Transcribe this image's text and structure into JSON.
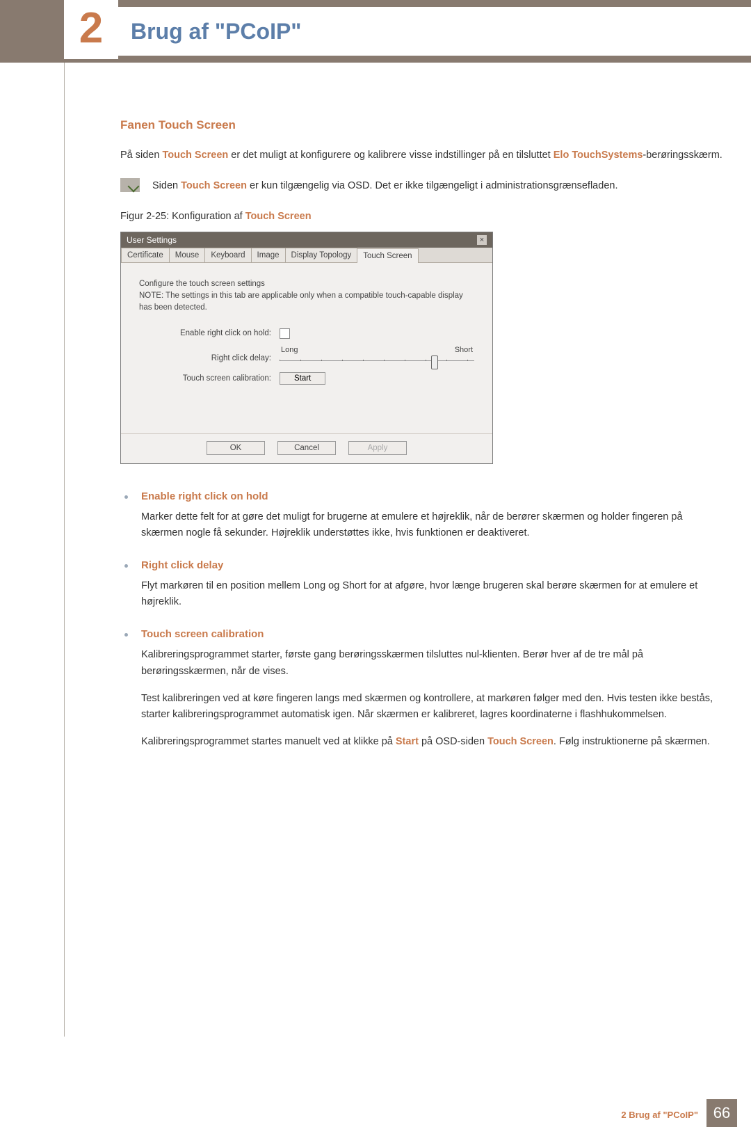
{
  "chapter": {
    "number": "2",
    "title": "Brug af \"PCoIP\""
  },
  "section": {
    "heading": "Fanen Touch Screen",
    "para1_pre": "På siden ",
    "para1_hl1": "Touch Screen",
    "para1_mid": " er det muligt at konfigurere og kalibrere visse indstillinger på en tilsluttet ",
    "para1_hl2": "Elo TouchSystems",
    "para1_post": "-berøringsskærm."
  },
  "note": {
    "pre": "Siden ",
    "hl": "Touch Screen",
    "post": " er kun tilgængelig via OSD. Det er ikke tilgængeligt i administrationsgrænsefladen."
  },
  "figure": {
    "caption_pre": "Figur 2-25: Konfiguration af ",
    "caption_hl": "Touch Screen"
  },
  "screenshot": {
    "window_title": "User Settings",
    "tabs": [
      "Certificate",
      "Mouse",
      "Keyboard",
      "Image",
      "Display Topology",
      "Touch Screen"
    ],
    "active_tab": "Touch Screen",
    "intro_line1": "Configure the touch screen settings",
    "intro_line2": "NOTE: The settings in this tab are applicable only when a compatible touch-capable display has been detected.",
    "labels": {
      "enable_hold": "Enable right click on hold:",
      "delay": "Right click delay:",
      "calibration": "Touch screen calibration:"
    },
    "slider": {
      "left": "Long",
      "right": "Short"
    },
    "start_button": "Start",
    "buttons": {
      "ok": "OK",
      "cancel": "Cancel",
      "apply": "Apply"
    }
  },
  "features": {
    "item1": {
      "title": "Enable right click on hold",
      "body": "Marker dette felt for at gøre det muligt for brugerne at emulere et højreklik, når de berører skærmen og holder fingeren på skærmen nogle få sekunder. Højreklik understøttes ikke, hvis funktionen er deaktiveret."
    },
    "item2": {
      "title": "Right click delay",
      "body": "Flyt markøren til en position mellem Long og Short for at afgøre, hvor længe brugeren skal berøre skærmen for at emulere et højreklik."
    },
    "item3": {
      "title": "Touch screen calibration",
      "body1": "Kalibreringsprogrammet starter, første gang berøringsskærmen tilsluttes nul-klienten. Berør hver af de tre mål på berøringsskærmen, når de vises.",
      "body2": "Test kalibreringen ved at køre fingeren langs med skærmen og kontrollere, at markøren følger med den. Hvis testen ikke bestås, starter kalibreringsprogrammet automatisk igen. Når skærmen er kalibreret, lagres koordinaterne i flashhukommelsen.",
      "body3_pre": "Kalibreringsprogrammet startes manuelt ved at klikke på ",
      "body3_hl1": "Start",
      "body3_mid": " på OSD-siden ",
      "body3_hl2": "Touch Screen",
      "body3_post": ". Følg instruktionerne på skærmen."
    }
  },
  "footer": {
    "text": "2 Brug af \"PCoIP\"",
    "page": "66"
  },
  "chart_data": null
}
